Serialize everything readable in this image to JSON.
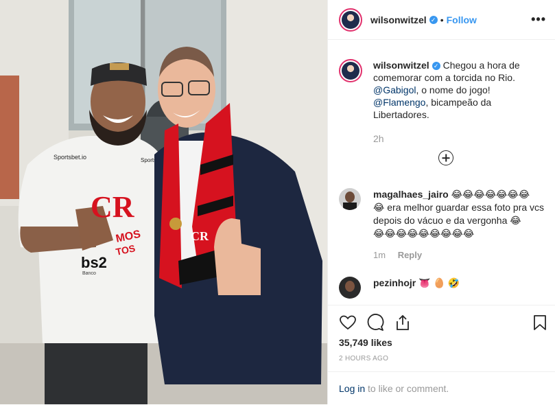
{
  "post": {
    "username": "wilsonwitzel",
    "follow_label": "Follow",
    "separator": "•",
    "more_label": "•••",
    "verified_mark": "✓"
  },
  "caption": {
    "username": "wilsonwitzel",
    "text_1": "Chegou a hora de comemorar com a torcida no Rio.",
    "mention_1": "@Gabigol",
    "text_2": ", o nome do jogo!",
    "mention_2": "@Flamengo",
    "text_3": ", bicampeão da Libertadores.",
    "time": "2h"
  },
  "comments": [
    {
      "username": "magalhaes_jairo",
      "emoji_head": "😂😂😂😂😂😂😂",
      "emoji_lead": "😂",
      "text": " era melhor guardar essa foto pra vcs depois do vácuo e da vergonha ",
      "emoji_tail": "😂",
      "emoji_line": "😂😂😂😂😂😂😂😂😂",
      "time": "1m",
      "reply_label": "Reply"
    },
    {
      "username": "pezinhojr",
      "text": "👅 🥚 🤣"
    }
  ],
  "stats": {
    "likes": "35,749 likes",
    "posted": "2 HOURS AGO"
  },
  "login": {
    "link": "Log in",
    "rest": " to like or comment."
  },
  "photo": {
    "shirt_text_1": "Sportsbet.io",
    "shirt_text_2": "Sportsbet.io",
    "sponsor": "bs2",
    "sponsor_sub": "Banco",
    "slogan": "MOS\nTOS"
  },
  "icons": {
    "heart": "heart-icon",
    "comment": "comment-icon",
    "share": "share-icon",
    "save": "bookmark-icon"
  },
  "colors": {
    "link_blue": "#3897f0",
    "mention_blue": "#003569",
    "muted": "#999999",
    "flamengo_red": "#d6121f"
  }
}
